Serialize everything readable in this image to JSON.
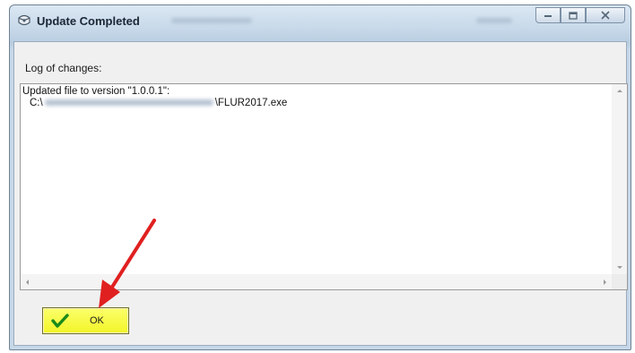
{
  "window": {
    "title": "Update Completed",
    "controls": {
      "minimize_icon": "minimize-icon",
      "maximize_icon": "maximize-icon",
      "close_icon": "close-icon"
    }
  },
  "log": {
    "label": "Log of changes:",
    "line1": "Updated file to version \"1.0.0.1\":",
    "line2_prefix": "C:\\",
    "line2_suffix": "\\FLUR2017.exe"
  },
  "ok_button": {
    "label": "OK",
    "icon": "checkmark-icon"
  },
  "colors": {
    "ok_button_bg": "#f5f72e",
    "checkmark": "#1a8a1a",
    "annotation_arrow": "#e02020"
  }
}
